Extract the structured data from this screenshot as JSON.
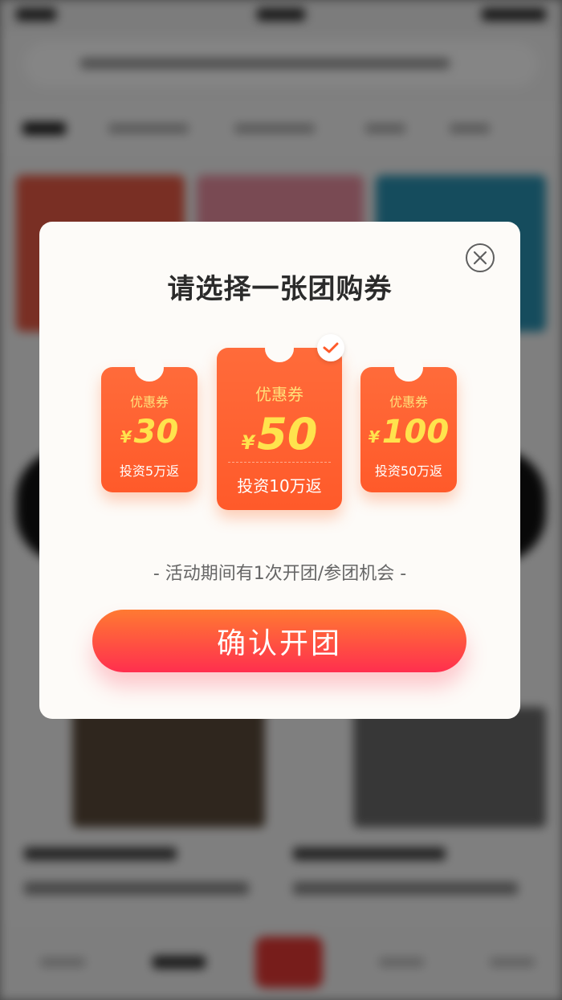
{
  "modal": {
    "title": "请选择一张团购券",
    "hint": "- 活动期间有1次开团/参团机会 -",
    "confirm_label": "确认开团"
  },
  "coupons": [
    {
      "kind": "优惠券",
      "currency": "¥",
      "amount": "30",
      "condition": "投资5万返",
      "selected": false
    },
    {
      "kind": "优惠券",
      "currency": "¥",
      "amount": "50",
      "condition": "投资10万返",
      "selected": true
    },
    {
      "kind": "优惠券",
      "currency": "¥",
      "amount": "100",
      "condition": "投资50万返",
      "selected": false
    }
  ],
  "icons": {
    "close": "close-icon",
    "check": "check-icon"
  },
  "colors": {
    "coupon": "#ff5f2e",
    "amount_text": "#ffe34d",
    "button_top": "#ff7a32",
    "button_bottom": "#ff2f4e"
  }
}
